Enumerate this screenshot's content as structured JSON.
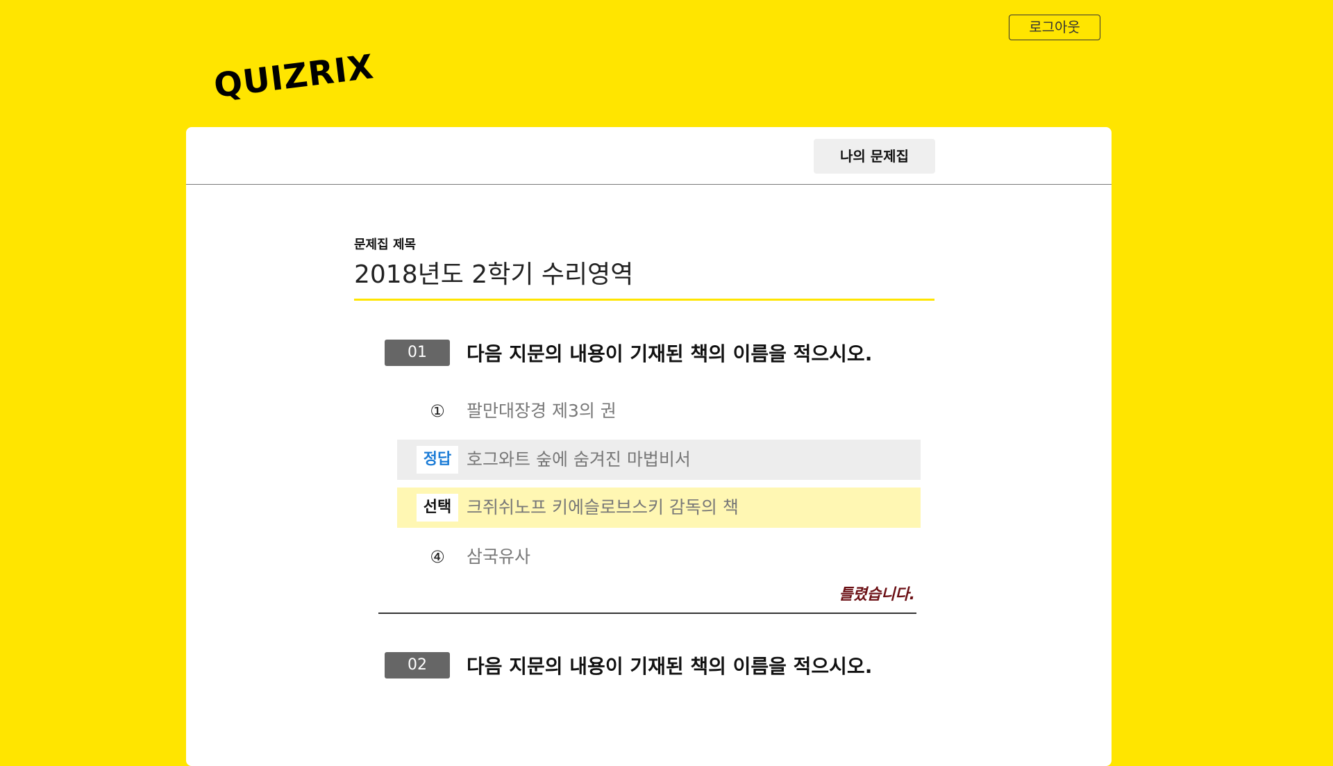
{
  "header": {
    "logout_label": "로그아웃",
    "logo_text": "QUIZRIX"
  },
  "nav": {
    "my_quiz_label": "나의 문제집"
  },
  "quiz": {
    "title_label": "문제집 제목",
    "title": "2018년도 2학기 수리영역"
  },
  "questions": [
    {
      "number": "01",
      "text": "다음 지문의 내용이 기재된 책의 이름을 적으시오.",
      "options": [
        {
          "marker": "①",
          "text": "팔만대장경 제3의 권",
          "state": "normal"
        },
        {
          "marker": "정답",
          "text": "호그와트 숲에 숨겨진 마법비서",
          "state": "correct"
        },
        {
          "marker": "선택",
          "text": "크쥐쉬노프 키에슬로브스키 감독의 책",
          "state": "selected"
        },
        {
          "marker": "④",
          "text": "삼국유사",
          "state": "normal"
        }
      ],
      "result": "틀렸습니다."
    },
    {
      "number": "02",
      "text": "다음 지문의 내용이 기재된 책의 이름을 적으시오."
    }
  ],
  "colors": {
    "background": "#FFE500",
    "correct_tag": "#1C7CD6",
    "selected_bg": "#FFF7B3",
    "correct_bg": "#EDEDED",
    "wrong_text": "#6B0F14"
  }
}
